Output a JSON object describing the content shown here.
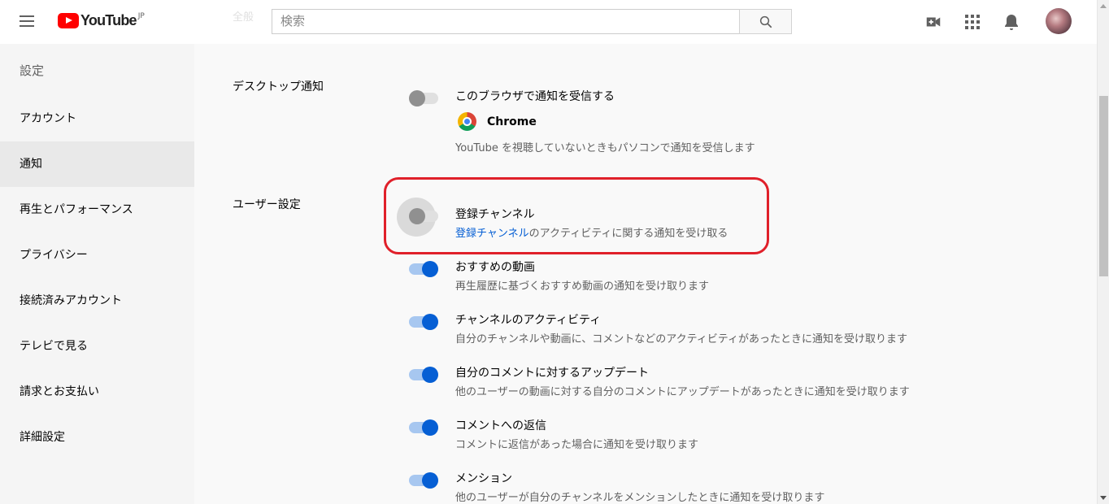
{
  "header": {
    "logo_text": "YouTube",
    "logo_country": "JP",
    "search_placeholder": "検索",
    "icons": [
      "menu-icon",
      "upload-video-icon",
      "apps-grid-icon",
      "notifications-bell-icon",
      "search-icon"
    ]
  },
  "ghost_text": "全般",
  "sidebar": {
    "title": "設定",
    "items": [
      {
        "label": "アカウント",
        "active": false
      },
      {
        "label": "通知",
        "active": true
      },
      {
        "label": "再生とパフォーマンス",
        "active": false
      },
      {
        "label": "プライバシー",
        "active": false
      },
      {
        "label": "接続済みアカウント",
        "active": false
      },
      {
        "label": "テレビで見る",
        "active": false
      },
      {
        "label": "請求とお支払い",
        "active": false
      },
      {
        "label": "詳細設定",
        "active": false
      }
    ]
  },
  "desktop": {
    "label": "デスクトップ通知",
    "option_title": "このブラウザで通知を受信する",
    "browser": "Chrome",
    "description": "YouTube を視聴していないときもパソコンで通知を受信します",
    "enabled": false
  },
  "user_settings": {
    "label": "ユーザー設定",
    "options": [
      {
        "title": "登録チャンネル",
        "desc_link": "登録チャンネル",
        "desc": "のアクティビティに関する通知を受け取る",
        "enabled": false
      },
      {
        "title": "おすすめの動画",
        "desc": "再生履歴に基づくおすすめ動画の通知を受け取ります",
        "enabled": true
      },
      {
        "title": "チャンネルのアクティビティ",
        "desc": "自分のチャンネルや動画に、コメントなどのアクティビティがあったときに通知を受け取ります",
        "enabled": true
      },
      {
        "title": "自分のコメントに対するアップデート",
        "desc": "他のユーザーの動画に対する自分のコメントにアップデートがあったときに通知を受け取ります",
        "enabled": true
      },
      {
        "title": "コメントへの返信",
        "desc": "コメントに返信があった場合に通知を受け取ります",
        "enabled": true
      },
      {
        "title": "メンション",
        "desc": "他のユーザーが自分のチャンネルをメンションしたときに通知を受け取ります",
        "enabled": true
      }
    ]
  },
  "colors": {
    "accent": "#065fd4",
    "highlight": "#e0202a",
    "brand": "#ff0000"
  }
}
